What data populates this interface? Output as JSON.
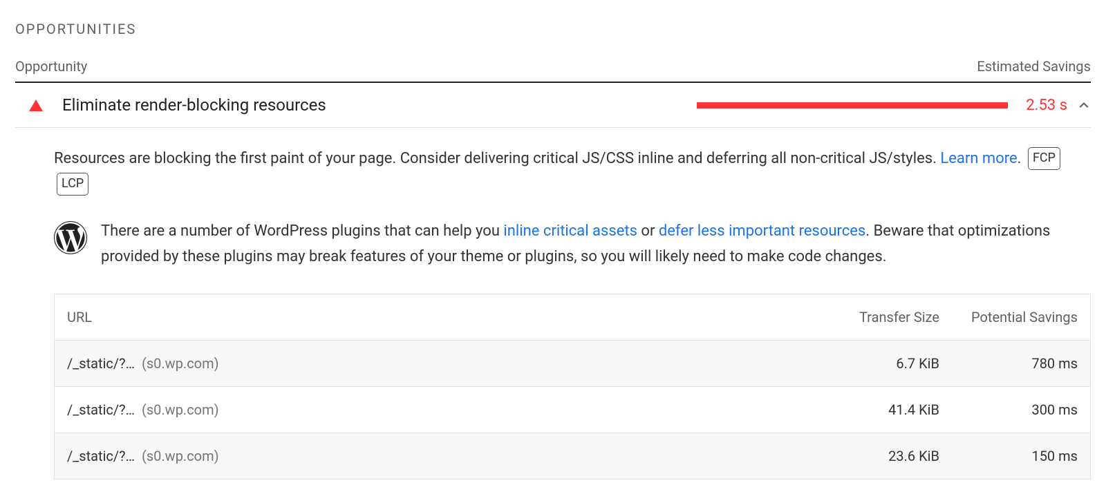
{
  "section_heading": "OPPORTUNITIES",
  "header": {
    "opportunity": "Opportunity",
    "estimated_savings": "Estimated Savings"
  },
  "opportunity": {
    "title": "Eliminate render-blocking resources",
    "savings": "2.53 s"
  },
  "description": {
    "text_before_link": "Resources are blocking the first paint of your page. Consider deliverin­g critical JS/CSS inline and deferring all non-critical JS/styles. ",
    "learn_more": "Learn more",
    "period": ".",
    "badges": [
      "FCP",
      "LCP"
    ]
  },
  "wordpress_tip": {
    "prefix": "There are a number of WordPress plugins that can help you ",
    "link1": "inline critical assets",
    "or": " or ",
    "link2": "defer less important resources",
    "suffix": ". Beware that optimizations provided by these plugins may break features of your theme or plugins, so you will likely need to make code changes."
  },
  "table": {
    "headers": {
      "url": "URL",
      "transfer_size": "Transfer Size",
      "potential_savings": "Potential Savings"
    },
    "rows": [
      {
        "path": "/_static/?…",
        "host": "(s0.wp.com)",
        "size": "6.7 KiB",
        "savings": "780 ms"
      },
      {
        "path": "/_static/?…",
        "host": "(s0.wp.com)",
        "size": "41.4 KiB",
        "savings": "300 ms"
      },
      {
        "path": "/_static/?…",
        "host": "(s0.wp.com)",
        "size": "23.6 KiB",
        "savings": "150 ms"
      }
    ]
  }
}
